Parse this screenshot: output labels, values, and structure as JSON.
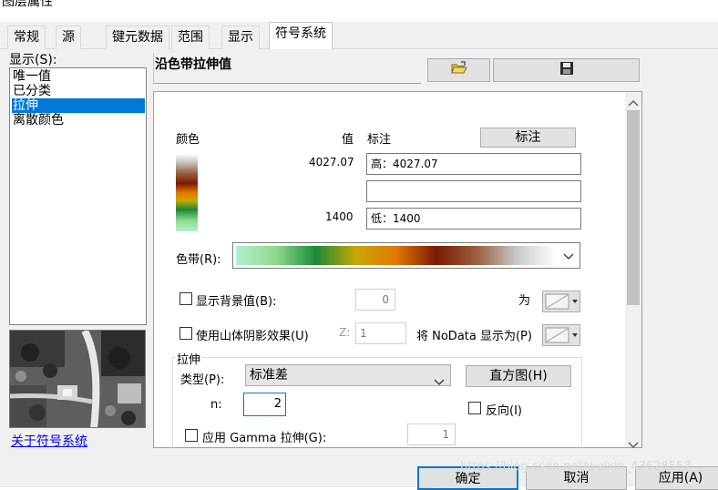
{
  "window": {
    "title": "图层属性"
  },
  "tabs": [
    {
      "label": "常规"
    },
    {
      "label": "源"
    },
    {
      "label": "键元数据"
    },
    {
      "label": "范围"
    },
    {
      "label": "显示"
    },
    {
      "label": "符号系统",
      "active": true
    }
  ],
  "sidebar": {
    "show_label": "显示(S):",
    "items": [
      {
        "label": "唯一值"
      },
      {
        "label": "已分类"
      },
      {
        "label": "拉伸",
        "selected": true
      },
      {
        "label": "离散颜色"
      }
    ],
    "about_link": "关于符号系统"
  },
  "header": {
    "title": "沿色带拉伸值",
    "open_icon": "folder-open-icon",
    "save_icon": "save-icon"
  },
  "legend": {
    "color_header": "颜色",
    "value_header": "值",
    "label_header": "标注",
    "label_button": "标注",
    "high_value": "4027.07",
    "high_label": "高：4027.07",
    "mid_label": "",
    "low_value": "1400",
    "low_label": "低：1400"
  },
  "ramp": {
    "label": "色带(R):",
    "colors": [
      "#b4eed0",
      "#8fd98c",
      "#1a8a3a",
      "#c8a800",
      "#e07800",
      "#7a1a00",
      "#9a6040",
      "#c9c9c9",
      "#ffffff"
    ]
  },
  "background": {
    "label": "显示背景值(B):",
    "value": "0",
    "as_label": "为"
  },
  "hillshade": {
    "label": "使用山体阴影效果(U)",
    "z_label": "Z:",
    "z_value": "1",
    "nodata_label": "将 NoData 显示为(P)"
  },
  "stretch": {
    "group_label": "拉伸",
    "type_label": "类型(P):",
    "type_value": "标准差",
    "histogram_button": "直方图(H)",
    "n_label": "n:",
    "n_value": "2",
    "invert_label": "反向(I)",
    "gamma_label": "应用 Gamma 拉伸(G):",
    "gamma_value": "1"
  },
  "footer": {
    "ok": "确定",
    "cancel": "取消",
    "apply": "应用(A)",
    "watermark": "https://blog.csdn.net/weixin_43628557"
  }
}
